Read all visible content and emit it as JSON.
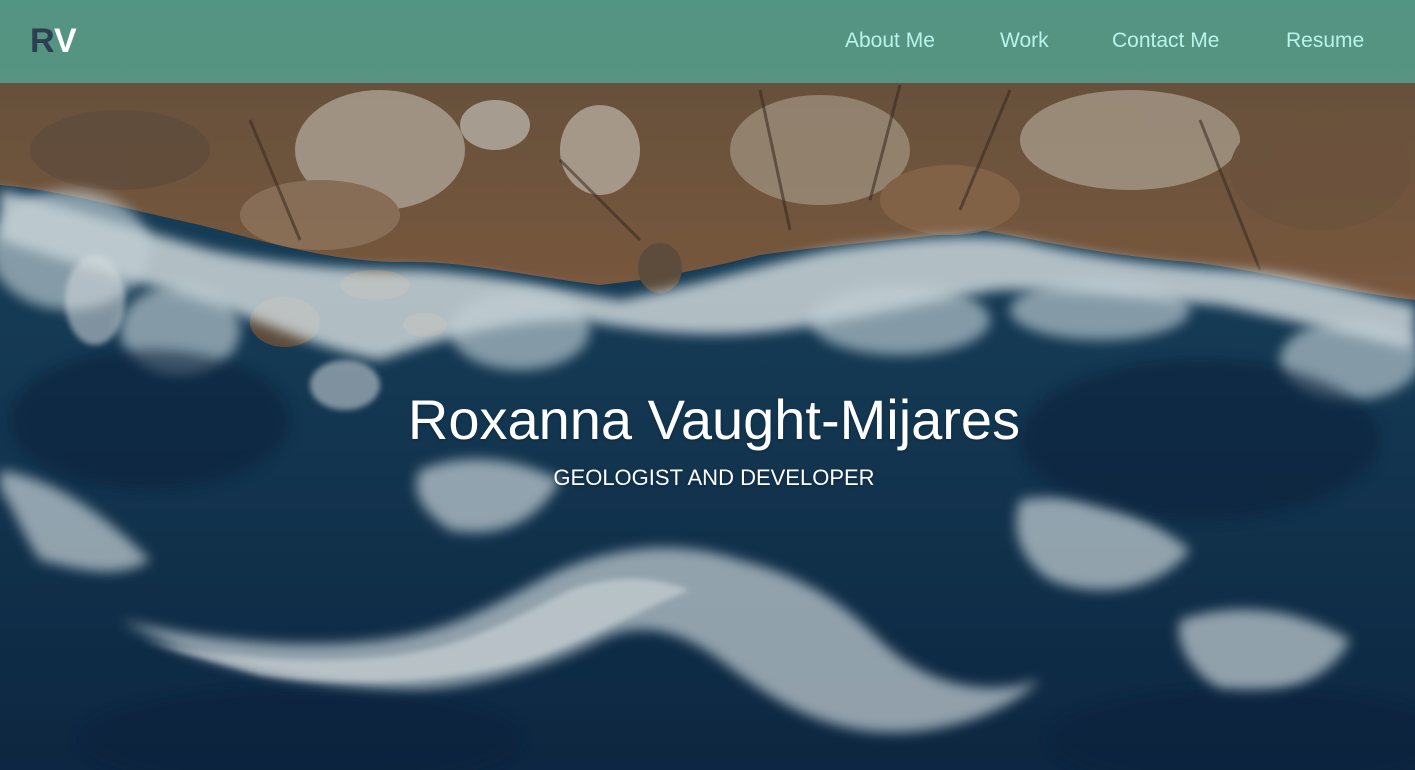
{
  "logo": {
    "first": "R",
    "second": "V"
  },
  "nav": {
    "items": [
      {
        "label": "About Me"
      },
      {
        "label": "Work"
      },
      {
        "label": "Contact Me"
      },
      {
        "label": "Resume"
      }
    ]
  },
  "hero": {
    "name": "Roxanna Vaught-Mijares",
    "subtitle": "GEOLOGIST AND DEVELOPER",
    "background": "aerial-coastline-photo"
  },
  "colors": {
    "navbar": "#4ebeaf",
    "nav_link": "#b9f3e9",
    "logo_r": "#2d3e52",
    "logo_v": "#ffffff",
    "text": "#ffffff"
  }
}
